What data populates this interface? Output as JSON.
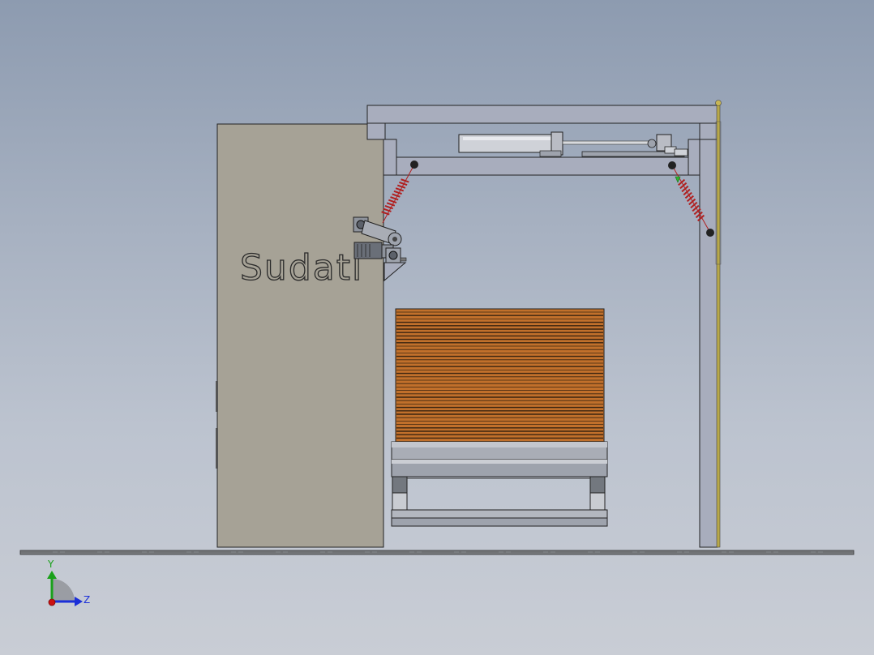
{
  "model": {
    "brand_label": "Sudatl"
  },
  "triad": {
    "y_label": "Y",
    "z_label": "Z",
    "colors": {
      "y": "#1aa11a",
      "z": "#1b2fd8",
      "x": "#cc1111"
    }
  },
  "colors": {
    "cabinet": "#a6a296",
    "frame": "#a8adbd",
    "stack": "#c1702b",
    "spring": "#b02020",
    "rail": "#b8a84a"
  }
}
